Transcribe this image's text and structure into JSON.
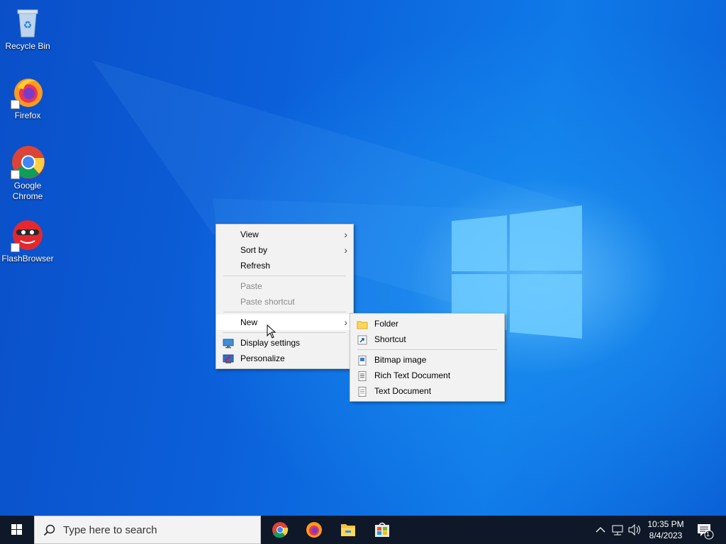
{
  "desktop": {
    "icons": [
      {
        "label": "Recycle Bin",
        "icon": "recycle-bin-icon"
      },
      {
        "label": "Firefox",
        "icon": "firefox-icon"
      },
      {
        "label": "Google\nChrome",
        "label_line1": "Google",
        "label_line2": "Chrome",
        "icon": "chrome-icon"
      },
      {
        "label": "FlashBrowser",
        "icon": "flashbrowser-icon"
      }
    ]
  },
  "context_menu": {
    "items": [
      {
        "label": "View",
        "has_submenu": true
      },
      {
        "label": "Sort by",
        "has_submenu": true
      },
      {
        "label": "Refresh"
      },
      {
        "label": "Paste",
        "disabled": true
      },
      {
        "label": "Paste shortcut",
        "disabled": true
      },
      {
        "label": "New",
        "has_submenu": true,
        "highlighted": true
      },
      {
        "label": "Display settings",
        "icon": "display-settings-icon"
      },
      {
        "label": "Personalize",
        "icon": "personalize-icon"
      }
    ]
  },
  "new_submenu": {
    "items": [
      {
        "label": "Folder",
        "icon": "folder-icon"
      },
      {
        "label": "Shortcut",
        "icon": "shortcut-icon"
      },
      {
        "label": "Bitmap image",
        "icon": "bitmap-icon"
      },
      {
        "label": "Rich Text Document",
        "icon": "rich-text-icon"
      },
      {
        "label": "Text Document",
        "icon": "text-document-icon"
      }
    ]
  },
  "taskbar": {
    "search_placeholder": "Type here to search",
    "pinned": [
      "chrome-icon",
      "firefox-icon",
      "file-explorer-icon",
      "store-icon"
    ],
    "clock": {
      "time": "10:35 PM",
      "date": "8/4/2023"
    },
    "notification_count": "1"
  },
  "colors": {
    "taskbar_bg": "#0e1828",
    "desktop_blue": "#0b5fd9",
    "menu_bg": "#f2f2f2"
  }
}
